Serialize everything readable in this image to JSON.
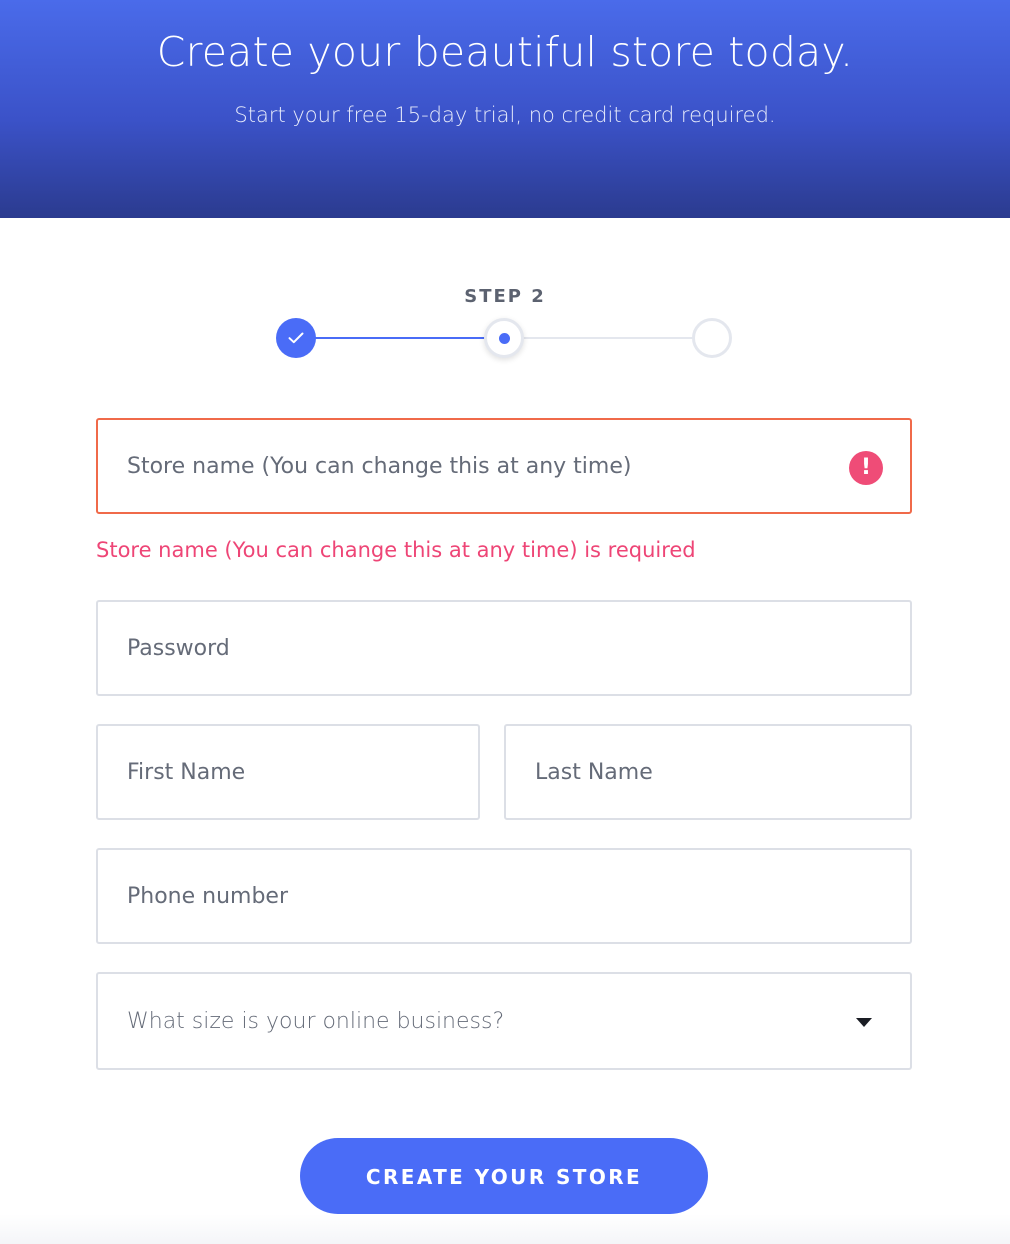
{
  "hero": {
    "title": "Create your beautiful store today.",
    "subtitle": "Start your free 15-day trial, no credit card required."
  },
  "stepper": {
    "label": "STEP 2",
    "current_step": 2,
    "total_steps": 3,
    "accent_color": "#4a6cf7"
  },
  "form": {
    "store_name": {
      "placeholder": "Store name (You can change this at any time)",
      "value": "",
      "error": "Store name (You can change this at any time) is required",
      "alert_icon": "!"
    },
    "password": {
      "placeholder": "Password",
      "value": ""
    },
    "first_name": {
      "placeholder": "First Name",
      "value": ""
    },
    "last_name": {
      "placeholder": "Last Name",
      "value": ""
    },
    "phone": {
      "placeholder": "Phone number",
      "value": ""
    },
    "business_size": {
      "selected": "What size is your online business?"
    },
    "submit_label": "CREATE YOUR STORE"
  },
  "colors": {
    "error_border": "#f06a4a",
    "error_text": "#ee4576",
    "hero_top": "#4a6bea",
    "hero_bottom": "#2b3b8f"
  }
}
